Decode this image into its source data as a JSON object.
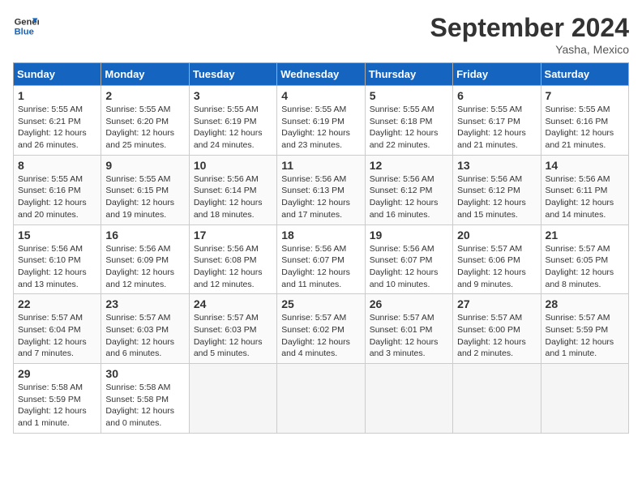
{
  "header": {
    "logo_line1": "General",
    "logo_line2": "Blue",
    "month": "September 2024",
    "location": "Yasha, Mexico"
  },
  "days_of_week": [
    "Sunday",
    "Monday",
    "Tuesday",
    "Wednesday",
    "Thursday",
    "Friday",
    "Saturday"
  ],
  "weeks": [
    [
      {
        "num": "1",
        "rise": "5:55 AM",
        "set": "6:21 PM",
        "daylight": "12 hours and 26 minutes."
      },
      {
        "num": "2",
        "rise": "5:55 AM",
        "set": "6:20 PM",
        "daylight": "12 hours and 25 minutes."
      },
      {
        "num": "3",
        "rise": "5:55 AM",
        "set": "6:19 PM",
        "daylight": "12 hours and 24 minutes."
      },
      {
        "num": "4",
        "rise": "5:55 AM",
        "set": "6:19 PM",
        "daylight": "12 hours and 23 minutes."
      },
      {
        "num": "5",
        "rise": "5:55 AM",
        "set": "6:18 PM",
        "daylight": "12 hours and 22 minutes."
      },
      {
        "num": "6",
        "rise": "5:55 AM",
        "set": "6:17 PM",
        "daylight": "12 hours and 21 minutes."
      },
      {
        "num": "7",
        "rise": "5:55 AM",
        "set": "6:16 PM",
        "daylight": "12 hours and 21 minutes."
      }
    ],
    [
      {
        "num": "8",
        "rise": "5:55 AM",
        "set": "6:16 PM",
        "daylight": "12 hours and 20 minutes."
      },
      {
        "num": "9",
        "rise": "5:55 AM",
        "set": "6:15 PM",
        "daylight": "12 hours and 19 minutes."
      },
      {
        "num": "10",
        "rise": "5:56 AM",
        "set": "6:14 PM",
        "daylight": "12 hours and 18 minutes."
      },
      {
        "num": "11",
        "rise": "5:56 AM",
        "set": "6:13 PM",
        "daylight": "12 hours and 17 minutes."
      },
      {
        "num": "12",
        "rise": "5:56 AM",
        "set": "6:12 PM",
        "daylight": "12 hours and 16 minutes."
      },
      {
        "num": "13",
        "rise": "5:56 AM",
        "set": "6:12 PM",
        "daylight": "12 hours and 15 minutes."
      },
      {
        "num": "14",
        "rise": "5:56 AM",
        "set": "6:11 PM",
        "daylight": "12 hours and 14 minutes."
      }
    ],
    [
      {
        "num": "15",
        "rise": "5:56 AM",
        "set": "6:10 PM",
        "daylight": "12 hours and 13 minutes."
      },
      {
        "num": "16",
        "rise": "5:56 AM",
        "set": "6:09 PM",
        "daylight": "12 hours and 12 minutes."
      },
      {
        "num": "17",
        "rise": "5:56 AM",
        "set": "6:08 PM",
        "daylight": "12 hours and 12 minutes."
      },
      {
        "num": "18",
        "rise": "5:56 AM",
        "set": "6:07 PM",
        "daylight": "12 hours and 11 minutes."
      },
      {
        "num": "19",
        "rise": "5:56 AM",
        "set": "6:07 PM",
        "daylight": "12 hours and 10 minutes."
      },
      {
        "num": "20",
        "rise": "5:57 AM",
        "set": "6:06 PM",
        "daylight": "12 hours and 9 minutes."
      },
      {
        "num": "21",
        "rise": "5:57 AM",
        "set": "6:05 PM",
        "daylight": "12 hours and 8 minutes."
      }
    ],
    [
      {
        "num": "22",
        "rise": "5:57 AM",
        "set": "6:04 PM",
        "daylight": "12 hours and 7 minutes."
      },
      {
        "num": "23",
        "rise": "5:57 AM",
        "set": "6:03 PM",
        "daylight": "12 hours and 6 minutes."
      },
      {
        "num": "24",
        "rise": "5:57 AM",
        "set": "6:03 PM",
        "daylight": "12 hours and 5 minutes."
      },
      {
        "num": "25",
        "rise": "5:57 AM",
        "set": "6:02 PM",
        "daylight": "12 hours and 4 minutes."
      },
      {
        "num": "26",
        "rise": "5:57 AM",
        "set": "6:01 PM",
        "daylight": "12 hours and 3 minutes."
      },
      {
        "num": "27",
        "rise": "5:57 AM",
        "set": "6:00 PM",
        "daylight": "12 hours and 2 minutes."
      },
      {
        "num": "28",
        "rise": "5:57 AM",
        "set": "5:59 PM",
        "daylight": "12 hours and 1 minute."
      }
    ],
    [
      {
        "num": "29",
        "rise": "5:58 AM",
        "set": "5:59 PM",
        "daylight": "12 hours and 1 minute."
      },
      {
        "num": "30",
        "rise": "5:58 AM",
        "set": "5:58 PM",
        "daylight": "12 hours and 0 minutes."
      },
      null,
      null,
      null,
      null,
      null
    ]
  ]
}
